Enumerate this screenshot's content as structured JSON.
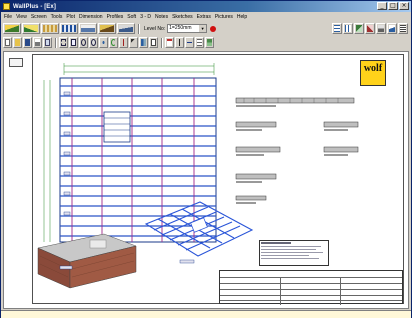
{
  "window": {
    "title": "WallPlus - [Ex]",
    "buttons": {
      "minimize": "_",
      "maximize": "□",
      "close": "×"
    }
  },
  "menu": [
    "File",
    "View",
    "Screen",
    "Tools",
    "Plot",
    "Dimension",
    "Profiles",
    "Soft",
    "3 - D",
    "Notes",
    "Sketches",
    "Extras",
    "Pictures",
    "Help"
  ],
  "toolbar": {
    "level_label": "Level No:",
    "level_value": "1=250mm"
  },
  "logo": {
    "text": "wolf",
    "sub": ""
  },
  "status": ""
}
